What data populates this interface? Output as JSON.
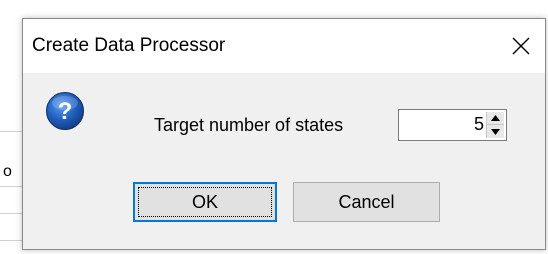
{
  "background": {
    "partial_text": "o"
  },
  "dialog": {
    "title": "Create Data Processor",
    "close_glyph": "✕",
    "prompt_label": "Target number of states",
    "spinner_value": "5",
    "ok_label": "OK",
    "cancel_label": "Cancel",
    "icon": "question-icon"
  },
  "colors": {
    "dialog_bg": "#f0f0f0",
    "titlebar_bg": "#ffffff",
    "focus_border": "#0078d7",
    "icon_blue": "#1f5fbf"
  }
}
